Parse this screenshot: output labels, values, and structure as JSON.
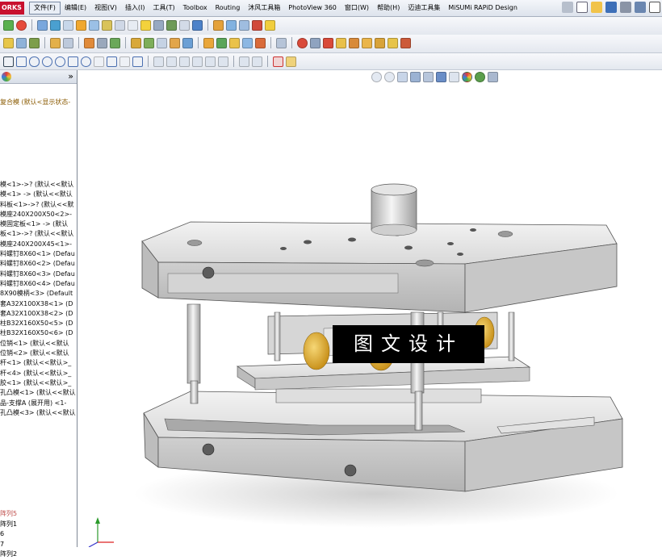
{
  "app": {
    "logo_text": "ORKS"
  },
  "menu": [
    {
      "label": "文件(F)",
      "active": true
    },
    {
      "label": "编辑(E)"
    },
    {
      "label": "视图(V)"
    },
    {
      "label": "插入(I)"
    },
    {
      "label": "工具(T)"
    },
    {
      "label": "Toolbox"
    },
    {
      "label": "Routing"
    },
    {
      "label": "沐风工具箱"
    },
    {
      "label": "PhotoView 360"
    },
    {
      "label": "窗口(W)"
    },
    {
      "label": "帮助(H)"
    },
    {
      "label": "迈迪工具集"
    },
    {
      "label": "MiSUMi RAPiD Design"
    }
  ],
  "panel": {
    "collapse_label": "»",
    "model_title": "复合模 (默认<显示状态-",
    "tree_items": [
      "模<1>->? (默认<<默认",
      "模<1> -> (默认<<默认",
      "料板<1>->? (默认<<默",
      "模座240X200X50<2>-",
      "模固定板<1> -> (默认",
      "板<1>->? (默认<<默认",
      "模座240X200X45<1>-",
      "料螺钉8X60<1> (Defau",
      "料螺钉8X60<2> (Defau",
      "料螺钉8X60<3> (Defau",
      "料螺钉8X60<4> (Defau",
      "8X90模柄<3> (Default",
      "套A32X100X38<1> (D",
      "套A32X100X38<2> (D",
      "柱B32X160X50<5> (D",
      "柱B32X160X50<6> (D",
      "位销<1> (默认<<默认",
      "位销<2> (默认<<默认",
      "杆<1> (默认<<默认>_",
      "杆<4> (默认<<默认>_",
      "胶<1> (默认<<默认>_",
      "孔凸模<1> (默认<<默认",
      "品-支撑A (展开用) <1-",
      "孔凸模<3> (默认<<默认"
    ],
    "pattern_items": [
      "阵列5",
      "阵列1",
      "6",
      "7",
      "阵列2"
    ]
  },
  "viewport": {
    "watermark": "图文设计"
  },
  "colors": {
    "accent": "#c8102e",
    "pattern_highlight": "#c0504d",
    "model_grey": "#d8d8d8",
    "spring_yellow": "#e8b93a"
  }
}
